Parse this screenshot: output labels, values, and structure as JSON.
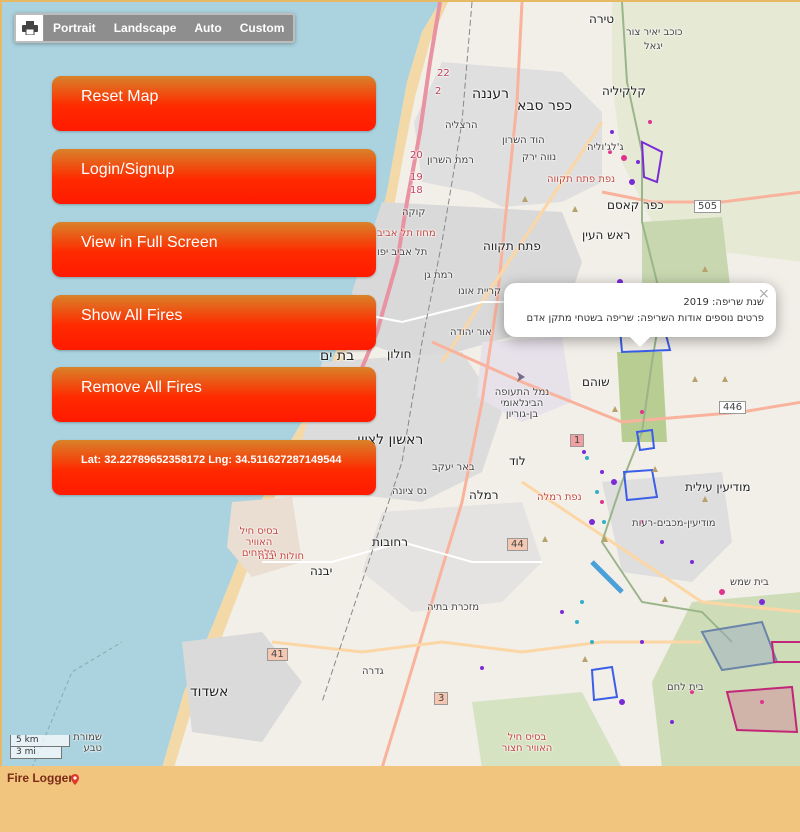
{
  "print_control": {
    "icon": "printer-icon",
    "options": [
      "Portrait",
      "Landscape",
      "Auto",
      "Custom"
    ]
  },
  "buttons": {
    "reset": "Reset Map",
    "login": "Login/Signup",
    "fullscreen": "View in Full Screen",
    "show_fires": "Show All Fires",
    "remove_fires": "Remove All Fires",
    "coords": "Lat: 32.22789652358172 Lng: 34.511627287149544"
  },
  "popup": {
    "line1": "שנת שריפה: 2019",
    "line2": "פרטים נוספים אודות השריפה: שריפה בשטחי מתקן אדם",
    "close": "×"
  },
  "places": [
    {
      "t": "טירה",
      "c": ""
    },
    {
      "t": "כוכב יאיר צור",
      "c": "small"
    },
    {
      "t": "יגאל",
      "c": "small"
    },
    {
      "t": "רעננה",
      "c": "big"
    },
    {
      "t": "כפר סבא",
      "c": "big"
    },
    {
      "t": "קלקיליה",
      "c": ""
    },
    {
      "t": "הרצליה",
      "c": ""
    },
    {
      "t": "הוד השרון",
      "c": "small"
    },
    {
      "t": "רמת השרון",
      "c": "small"
    },
    {
      "t": "ג'לג'וליה",
      "c": "small"
    },
    {
      "t": "נווה ירק",
      "c": "small"
    },
    {
      "t": "נפת פתח תקווה",
      "c": "red"
    },
    {
      "t": "כפר קאסם",
      "c": ""
    },
    {
      "t": "קוקה",
      "c": "small"
    },
    {
      "t": "מחוז תל אביב",
      "c": "red"
    },
    {
      "t": "ראש העין",
      "c": ""
    },
    {
      "t": "פתח תקווה",
      "c": ""
    },
    {
      "t": "תל אביב יפו",
      "c": "small"
    },
    {
      "t": "רמת גן",
      "c": "small"
    },
    {
      "t": "קריית אונו",
      "c": "small"
    },
    {
      "t": "אור יהודה",
      "c": "small"
    },
    {
      "t": "בת ים",
      "c": "big"
    },
    {
      "t": "חולון",
      "c": ""
    },
    {
      "t": "נמל התעופה הבינלאומי בן-גוריון",
      "c": "small"
    },
    {
      "t": "שוהם",
      "c": ""
    },
    {
      "t": "ראשון לציון",
      "c": "big"
    },
    {
      "t": "באר יעקב",
      "c": "small"
    },
    {
      "t": "לוד",
      "c": ""
    },
    {
      "t": "נס ציונה",
      "c": "small"
    },
    {
      "t": "רמלה",
      "c": ""
    },
    {
      "t": "נפת רמלה",
      "c": "red"
    },
    {
      "t": "מודיעין עילית",
      "c": ""
    },
    {
      "t": "מודיעין-מכבים-רעות",
      "c": "small"
    },
    {
      "t": "בסיס חיל האוויר פלמחים",
      "c": "red"
    },
    {
      "t": "חולות יבנה",
      "c": "red"
    },
    {
      "t": "רחובות",
      "c": ""
    },
    {
      "t": "יבנה",
      "c": ""
    },
    {
      "t": "מזכרת בתיה",
      "c": "small"
    },
    {
      "t": "גדרה",
      "c": "small"
    },
    {
      "t": "אשדוד",
      "c": "big"
    },
    {
      "t": "בית שמש",
      "c": "small"
    },
    {
      "t": "בסיס חיל האוויר חצור",
      "c": "red"
    },
    {
      "t": "שמורת טבע",
      "c": "small"
    },
    {
      "t": "בית לחם",
      "c": "small"
    }
  ],
  "roads": [
    "22",
    "2",
    "20",
    "19",
    "18",
    "505",
    "446",
    "1",
    "44",
    "41",
    "3"
  ],
  "scale": {
    "km": "5 km",
    "mi": "3 mi"
  },
  "footer": {
    "brand": "Fire Logger",
    "pin_icon": "map-pin-icon"
  },
  "colors": {
    "sea": "#aad3df",
    "land": "#f2efe9",
    "urban": "#dddddd",
    "forest": "#add19e",
    "fire_blue": "#3b5ee8",
    "fire_purple": "#7a2bd6",
    "fire_pink": "#e0338f",
    "button_top": "#d8822a",
    "button_bottom": "#ff1a00",
    "footer": "#f1c57e"
  }
}
